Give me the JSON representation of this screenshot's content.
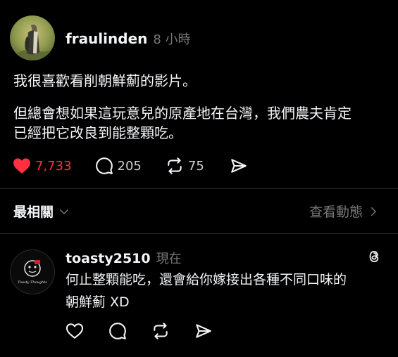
{
  "post": {
    "author": "fraulinden",
    "time": "8 小時",
    "text_lines": [
      "我很喜歡看削朝鮮薊的影片。",
      "但總會想如果這玩意兒的原產地在台灣，我們農夫肯定",
      "已經把它改良到能整顆吃。"
    ],
    "likes": "7,733",
    "replies": "205",
    "reposts": "75",
    "liked": true
  },
  "sort": {
    "label": "最相關",
    "view_activity": "查看動態"
  },
  "reply": {
    "author": "toasty2510",
    "time": "現在",
    "avatar_text": "Toasty Thoughts",
    "text_lines": [
      "何止整顆能吃，還會給你嫁接出各種不同口味的",
      "朝鮮薊 XD"
    ]
  },
  "colors": {
    "background": "#000000",
    "text": "#f3f5f7",
    "muted": "#777777",
    "like": "#ff3040",
    "divider": "#2a2a2a"
  },
  "icons": {
    "like": "heart-icon",
    "reply": "comment-bubble-icon",
    "repost": "repost-icon",
    "share": "send-icon",
    "sort": "chevron-down-icon",
    "activity": "chevron-right-icon",
    "app": "threads-icon"
  }
}
